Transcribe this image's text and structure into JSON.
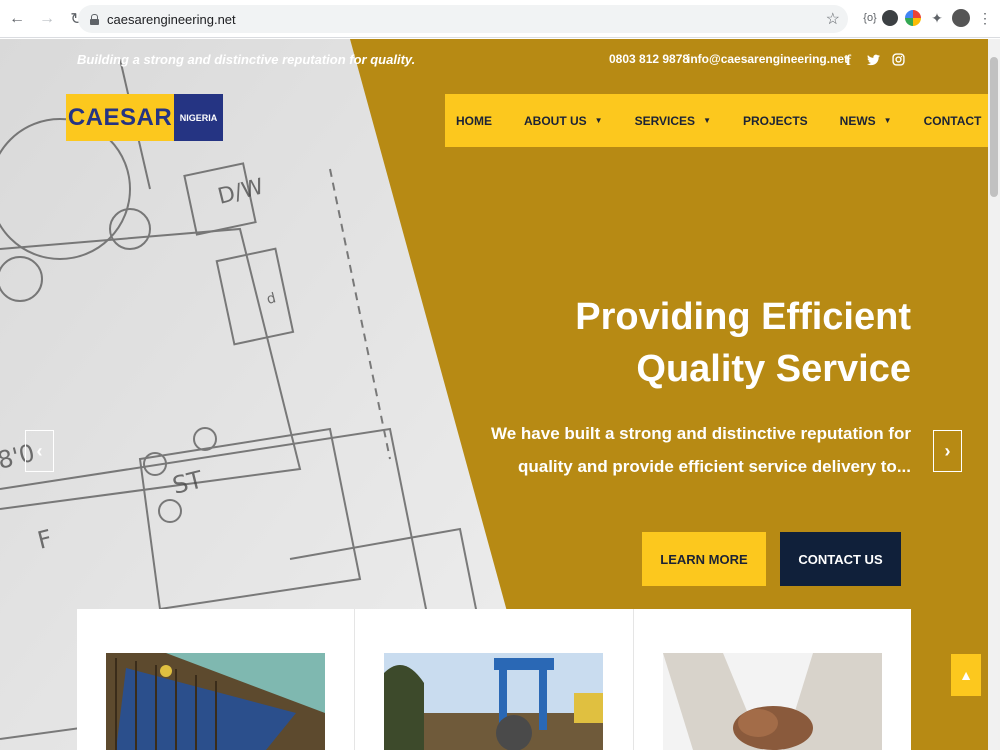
{
  "browser": {
    "url": "caesarengineering.net"
  },
  "topbar": {
    "tagline": "Building a strong and distinctive reputation for quality.",
    "phone": "0803 812 9878",
    "email": "info@caesarengineering.net"
  },
  "logo": {
    "main": "CAESAR",
    "sub": "NIGERIA"
  },
  "nav": {
    "items": [
      {
        "label": "HOME",
        "dropdown": false
      },
      {
        "label": "ABOUT US",
        "dropdown": true
      },
      {
        "label": "SERVICES",
        "dropdown": true
      },
      {
        "label": "PROJECTS",
        "dropdown": false
      },
      {
        "label": "NEWS",
        "dropdown": true
      },
      {
        "label": "CONTACT",
        "dropdown": false
      }
    ]
  },
  "hero": {
    "title": "Providing Efficient Quality Service",
    "subtitle": "We have built a strong and distinctive reputation for quality and provide efficient service delivery to...",
    "learn_more": "LEARN MORE",
    "contact_us": "CONTACT US",
    "prev": "‹",
    "next": "›"
  },
  "colors": {
    "brand_yellow": "#fcc81e",
    "hero_gold": "#b78a14",
    "brand_blue": "#253483",
    "navy": "#10203a"
  }
}
